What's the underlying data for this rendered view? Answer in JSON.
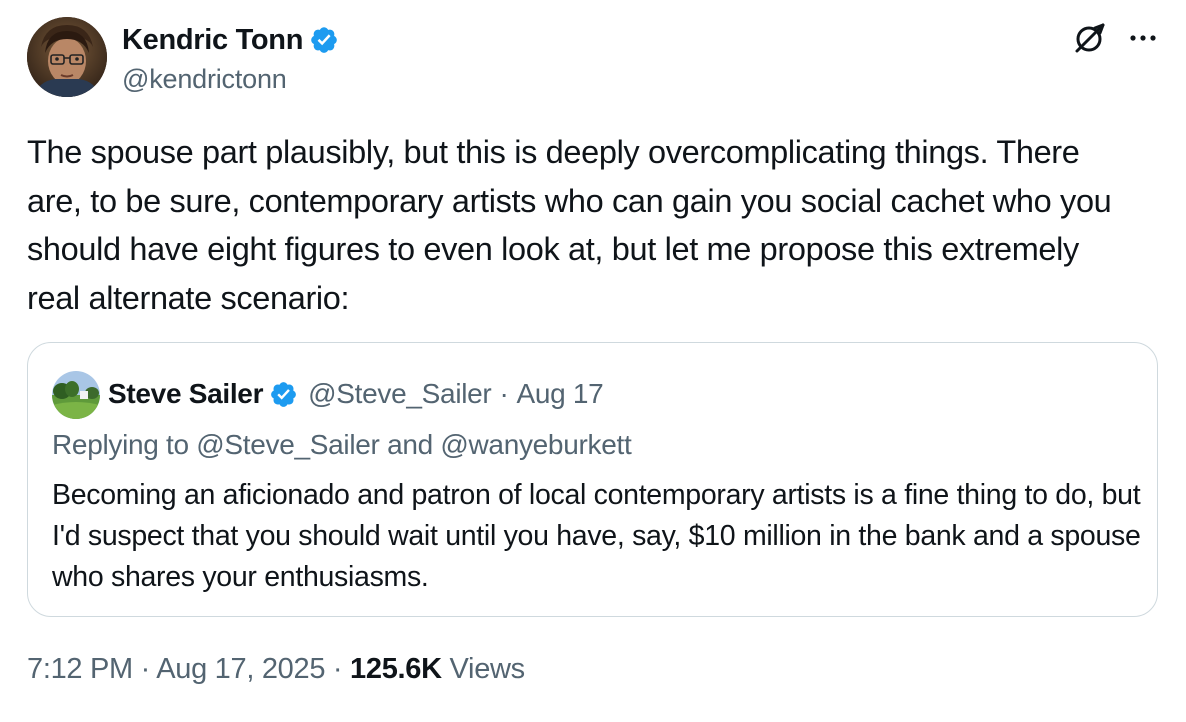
{
  "author": {
    "name": "Kendric Tonn",
    "handle": "@kendrictonn",
    "verified": true,
    "avatar_icon": "avatar-photo"
  },
  "actions": {
    "grok_icon": "grok-icon",
    "more_icon": "more-icon"
  },
  "tweet": {
    "text": "The spouse part plausibly, but this is deeply overcomplicating things. There are, to be sure, contemporary artists who can gain you social cachet who you should have eight figures to even look at, but let me propose this extremely real alternate scenario:"
  },
  "quote": {
    "name": "Steve Sailer",
    "handle": "@Steve_Sailer",
    "separator": "·",
    "date": "Aug 17",
    "replying_prefix": "Replying to",
    "replying_user1": "@Steve_Sailer",
    "replying_and": "and",
    "replying_user2": "@wanyeburkett",
    "text": "Becoming an aficionado and patron of local contemporary artists is a fine thing to do, but I'd suspect that you should wait until you have, say, $10 million in the bank and a spouse who shares your enthusiasms."
  },
  "meta": {
    "time": "7:12 PM",
    "sep1": "·",
    "date": "Aug 17, 2025",
    "sep2": "·",
    "views_count": "125.6K",
    "views_label": "Views"
  },
  "colors": {
    "text": "#0f1419",
    "secondary": "#536471",
    "verified_blue": "#1d9bf0",
    "border": "#cfd9de"
  }
}
